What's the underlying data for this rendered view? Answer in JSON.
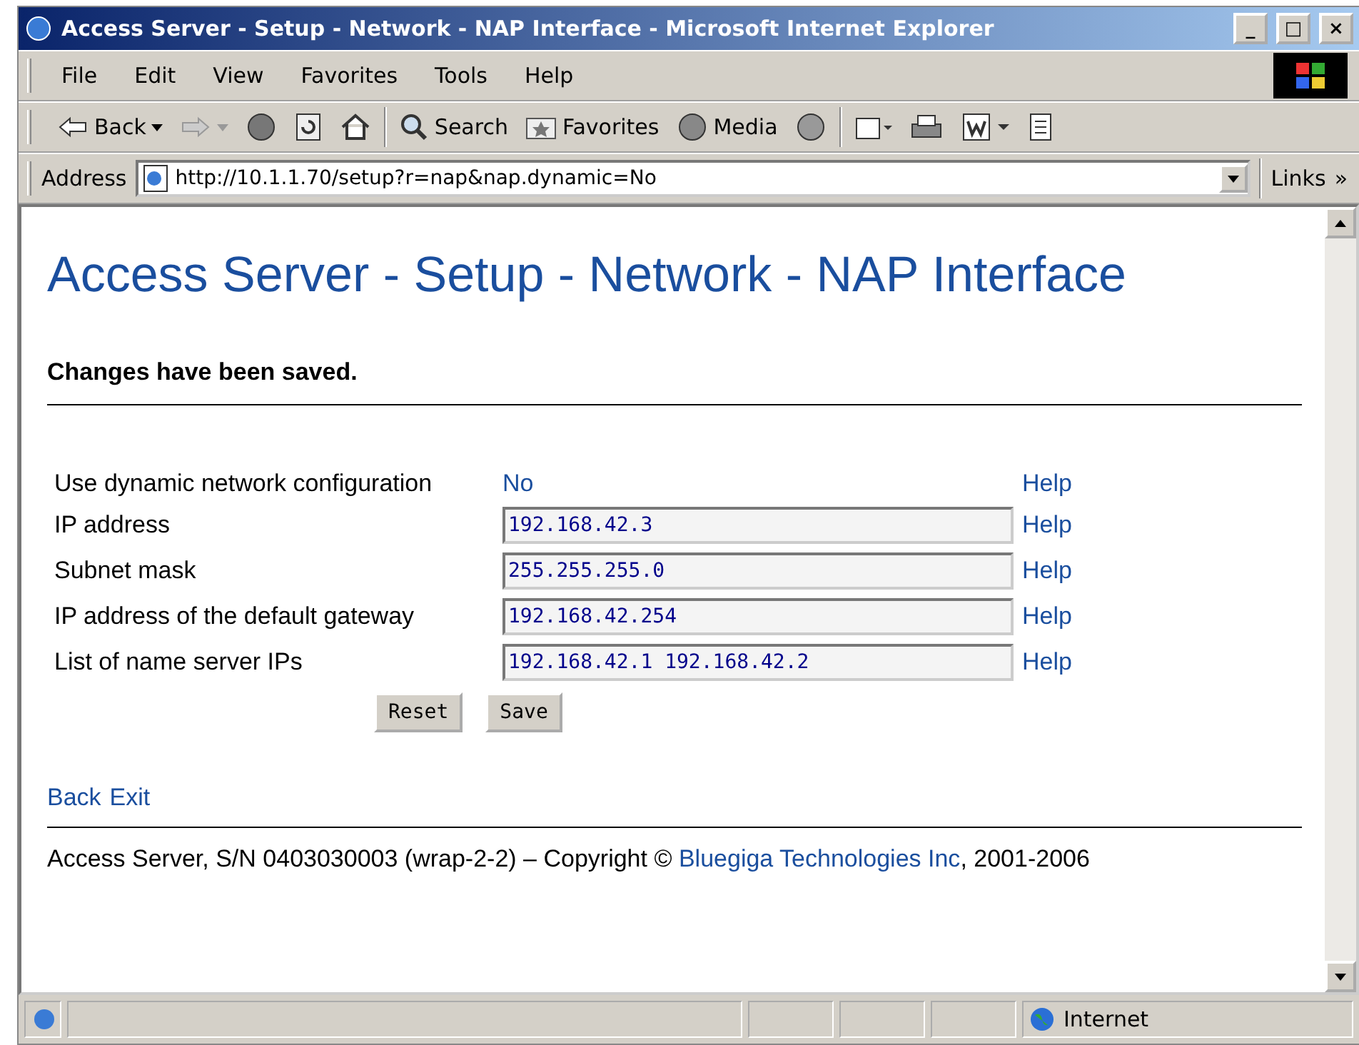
{
  "window": {
    "title": "Access Server - Setup - Network - NAP Interface - Microsoft Internet Explorer",
    "controls": [
      "_",
      "□",
      "×"
    ]
  },
  "menu": [
    "File",
    "Edit",
    "View",
    "Favorites",
    "Tools",
    "Help"
  ],
  "toolbar": [
    {
      "kind": "back",
      "label": "Back"
    },
    {
      "kind": "forward"
    },
    {
      "kind": "stop"
    },
    {
      "kind": "refresh"
    },
    {
      "kind": "home"
    },
    {
      "kind": "search",
      "label": "Search"
    },
    {
      "kind": "favorites",
      "label": "Favorites"
    },
    {
      "kind": "media",
      "label": "Media"
    },
    {
      "kind": "history"
    },
    {
      "kind": "mail"
    },
    {
      "kind": "print"
    },
    {
      "kind": "edit"
    },
    {
      "kind": "discuss"
    }
  ],
  "address": {
    "label": "Address",
    "value": "http://10.1.1.70/setup?r=nap&nap.dynamic=No",
    "links": "Links",
    "more": "»"
  },
  "page": {
    "heading": "Access Server - Setup - Network - NAP Interface",
    "message": "Changes have been saved.",
    "rows": [
      {
        "kind": "link",
        "label": "Use dynamic network configuration",
        "value": "No",
        "help": "Help"
      },
      {
        "kind": "input",
        "label": "IP address",
        "value": "192.168.42.3",
        "help": "Help"
      },
      {
        "kind": "input",
        "label": "Subnet mask",
        "value": "255.255.255.0",
        "help": "Help"
      },
      {
        "kind": "input",
        "label": "IP address of the default gateway",
        "value": "192.168.42.254",
        "help": "Help"
      },
      {
        "kind": "input",
        "label": "List of name server IPs",
        "value": "192.168.42.1 192.168.42.2",
        "help": "Help"
      }
    ],
    "buttons": [
      "Reset",
      "Save"
    ],
    "nav_links": [
      "Back",
      "Exit"
    ],
    "footer": {
      "text": "Access Server, S/N 0403030003 (wrap-2-2)  –  Copyright ©",
      "link": "Bluegiga Technologies Inc",
      "suffix": ", 2001-2006"
    }
  },
  "status_bar": {
    "zone": "Internet"
  }
}
